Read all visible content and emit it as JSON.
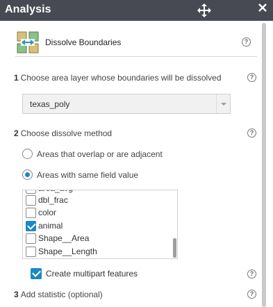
{
  "titlebar": {
    "title": "Analysis",
    "move_icon": "move-icon",
    "close_icon": "close-icon"
  },
  "tool": {
    "title": "Dissolve Boundaries",
    "icon": "dissolve-boundaries-icon"
  },
  "help_glyph": "?",
  "steps": [
    {
      "num": "1",
      "label": "Choose area layer whose boundaries will be dissolved"
    },
    {
      "num": "2",
      "label": "Choose dissolve method"
    },
    {
      "num": "3",
      "label": "Add statistic (optional)"
    }
  ],
  "layer_select": {
    "value": "texas_poly"
  },
  "method": {
    "options": [
      {
        "label": "Areas that overlap or are adjacent",
        "checked": false
      },
      {
        "label": "Areas with same field value",
        "checked": true
      }
    ]
  },
  "fields": [
    {
      "label": "area_avg",
      "checked": false
    },
    {
      "label": "dbl_frac",
      "checked": false
    },
    {
      "label": "color",
      "checked": false
    },
    {
      "label": "animal",
      "checked": true
    },
    {
      "label": "Shape__Area",
      "checked": false
    },
    {
      "label": "Shape__Length",
      "checked": false
    }
  ],
  "multipart": {
    "label": "Create multipart features",
    "checked": true
  },
  "colors": {
    "titlebar": "#474a52",
    "accent": "#1c88c7"
  }
}
